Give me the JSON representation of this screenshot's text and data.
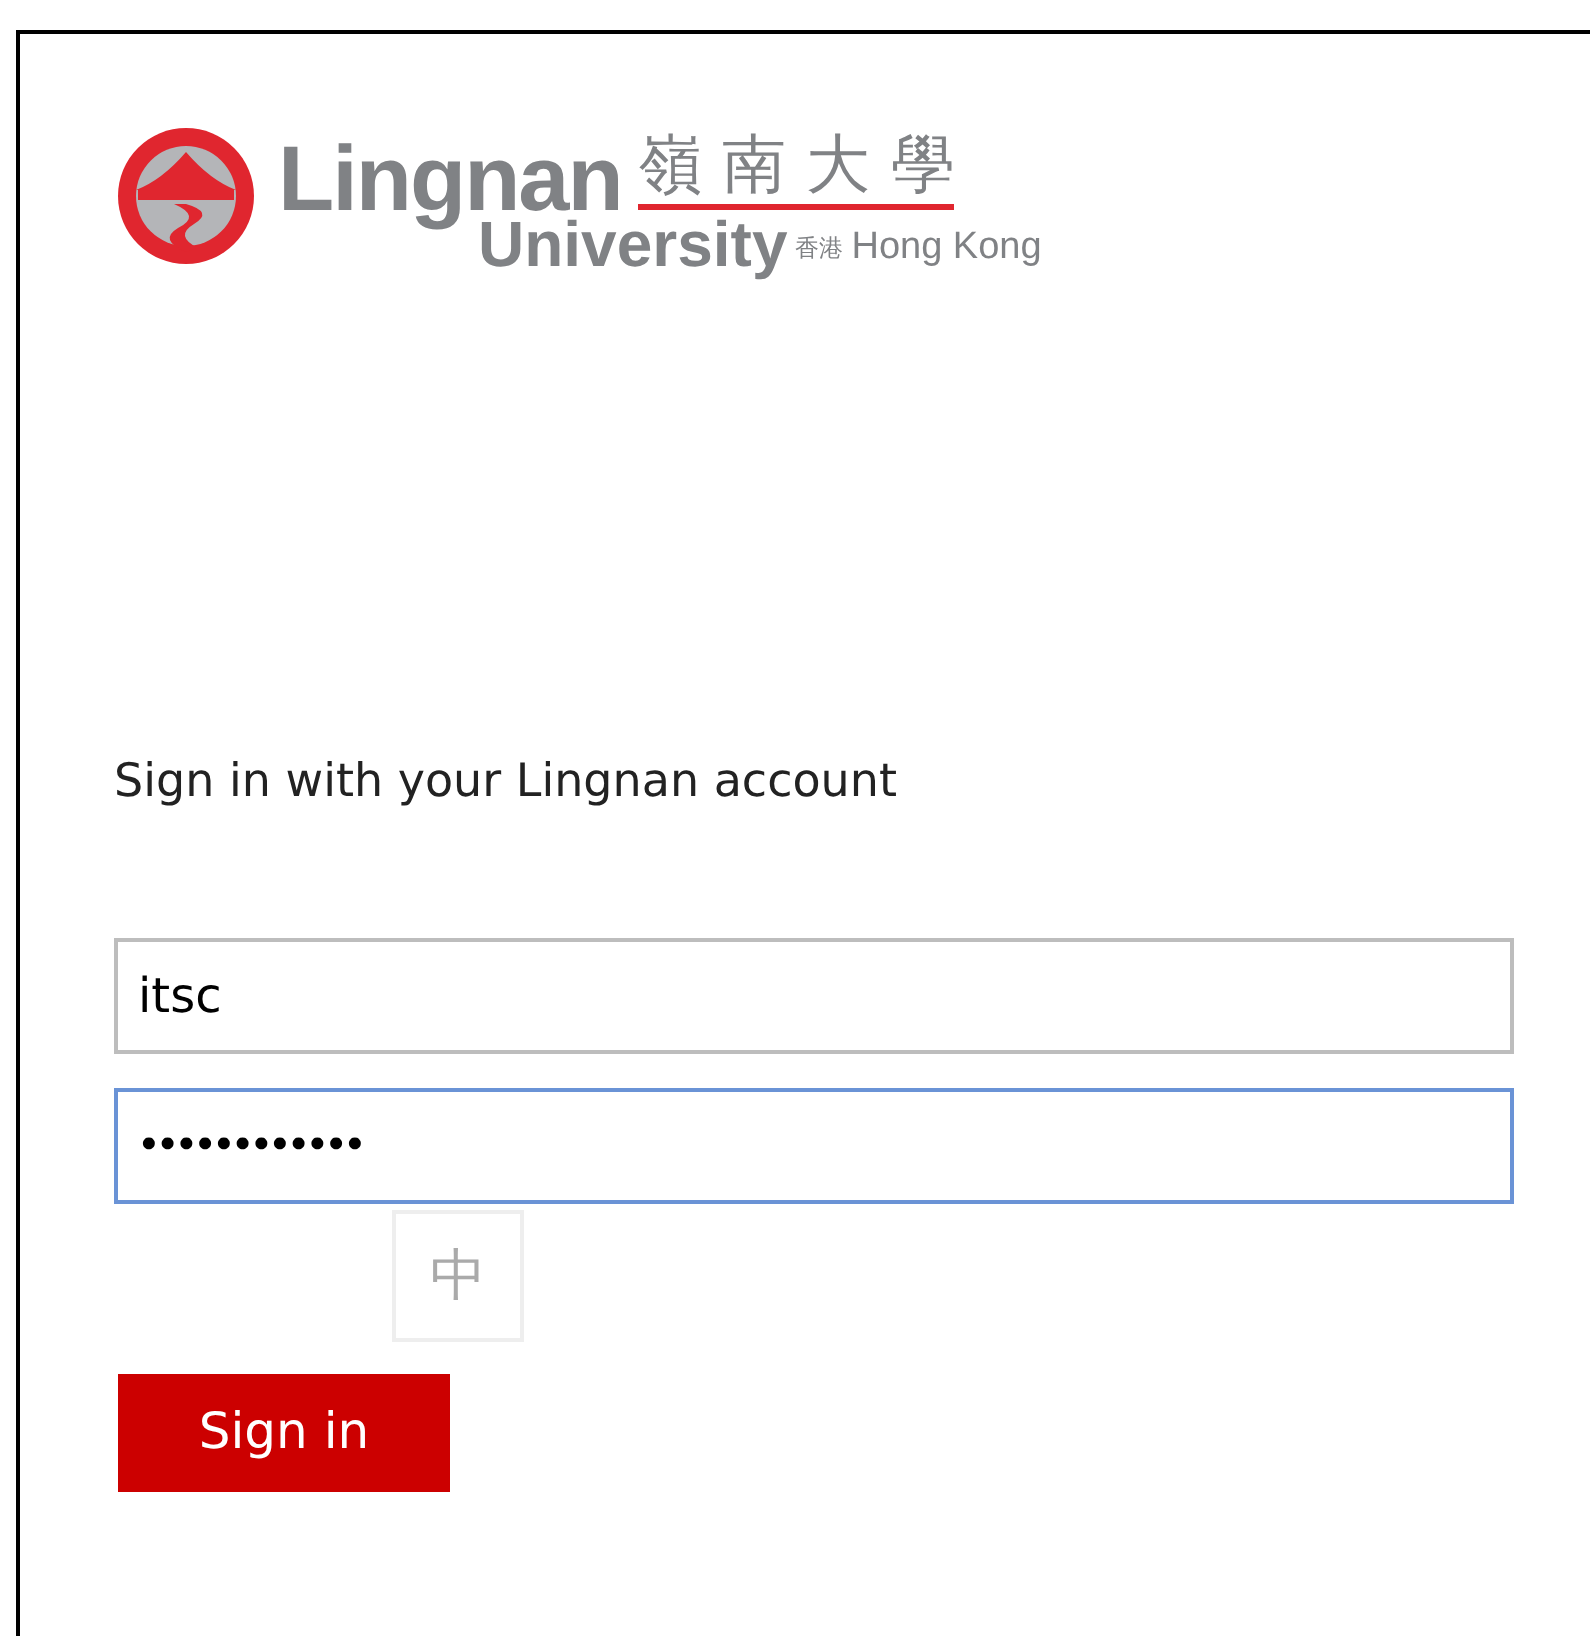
{
  "logo": {
    "name": "Lingnan",
    "chinese_name": "嶺 南 大 學",
    "subtitle": "University",
    "location_chinese": "香港",
    "location": "Hong Kong"
  },
  "heading": "Sign in with your Lingnan account",
  "fields": [
    {
      "kind": "text",
      "value": "itsc",
      "focused": false
    },
    {
      "kind": "password",
      "value": "••••••••••••",
      "focused": true
    }
  ],
  "ime_indicator": "中",
  "button": "Sign in"
}
